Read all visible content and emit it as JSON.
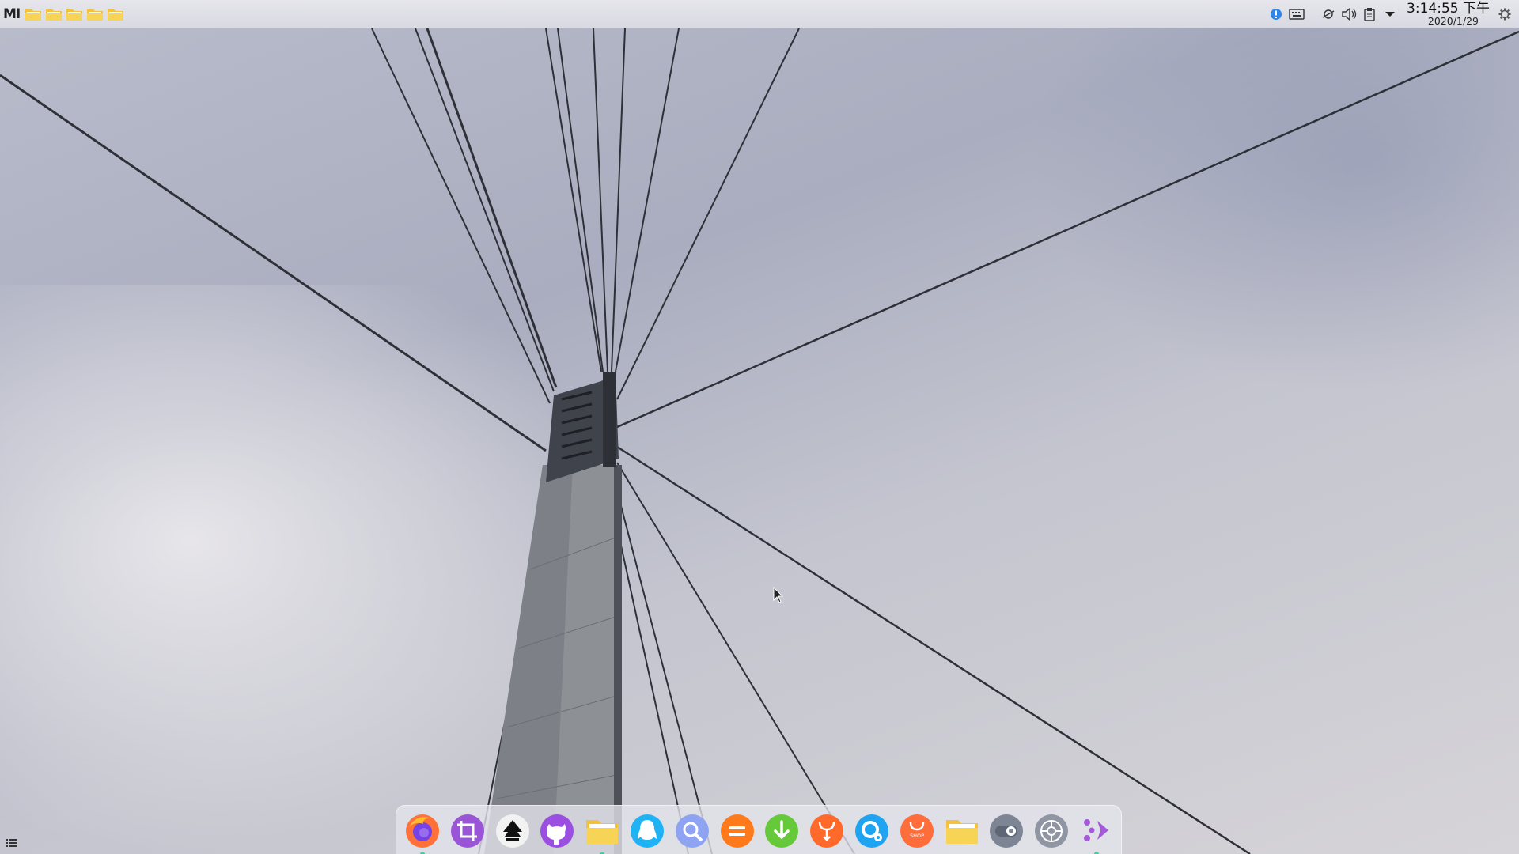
{
  "top_panel": {
    "logo_text": "MI",
    "pinned_folders": [
      "folder-icon",
      "folder-icon",
      "folder-icon",
      "folder-icon",
      "folder-icon"
    ],
    "tray_icons": [
      "info-icon",
      "keyboard-icon",
      "network-icon",
      "volume-icon",
      "clipboard-icon",
      "expand-tray-icon"
    ],
    "clock": {
      "time": "3:14:55 下午",
      "date": "2020/1/29"
    },
    "settings_icon": "gear-icon"
  },
  "dock": {
    "items": [
      {
        "name": "firefox",
        "icon": "firefox-icon",
        "color": "#ff7139",
        "running": true
      },
      {
        "name": "screenshot",
        "icon": "crop-icon",
        "color": "#9a55d6",
        "running": false
      },
      {
        "name": "inkscape",
        "icon": "inkscape-icon",
        "color": "#f2f2f2",
        "running": false
      },
      {
        "name": "github",
        "icon": "github-icon",
        "color": "#9b4fe0",
        "running": false
      },
      {
        "name": "file-manager",
        "icon": "folder-icon",
        "color": "#f6c945",
        "running": true
      },
      {
        "name": "qq",
        "icon": "penguin-icon",
        "color": "#1fb2f5",
        "running": false
      },
      {
        "name": "search",
        "icon": "magnifier-icon",
        "color": "#8ea4f2",
        "running": false
      },
      {
        "name": "notes",
        "icon": "equals-icon",
        "color": "#ff7a1a",
        "running": false
      },
      {
        "name": "downloader",
        "icon": "download-icon",
        "color": "#66c93a",
        "running": false
      },
      {
        "name": "package-installer",
        "icon": "install-icon",
        "color": "#ff6a2b",
        "running": false
      },
      {
        "name": "settings-tool",
        "icon": "tool-icon",
        "color": "#1ea4f0",
        "running": false
      },
      {
        "name": "app-store",
        "icon": "shop-icon",
        "color": "#ff6d3b",
        "running": false
      },
      {
        "name": "folders",
        "icon": "folder-icon",
        "color": "#f8c93f",
        "running": false
      },
      {
        "name": "toggle",
        "icon": "toggle-icon",
        "color": "#7d8594",
        "running": false
      },
      {
        "name": "system-settings",
        "icon": "gear-icon",
        "color": "#8f95a3",
        "running": false
      },
      {
        "name": "launcher",
        "icon": "launcher-icon",
        "color": "#a45ad8",
        "running": true
      }
    ],
    "shop_label": "SHOP"
  }
}
